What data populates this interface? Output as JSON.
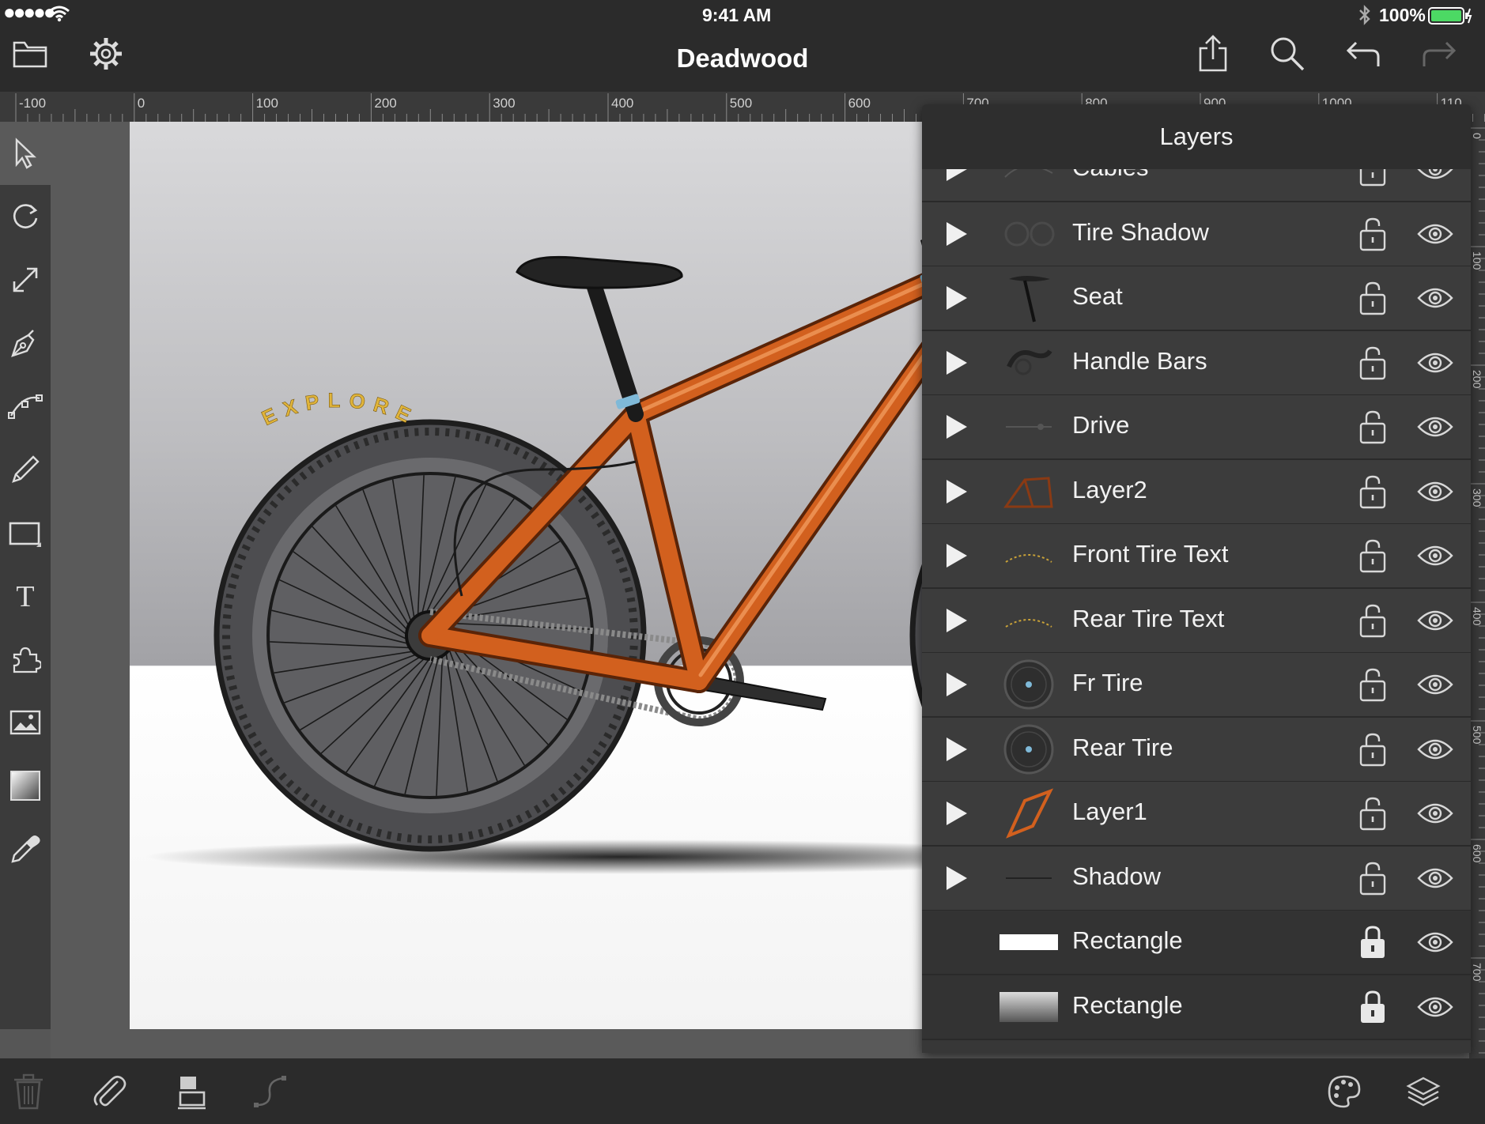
{
  "status_bar": {
    "signal": "●●●●●",
    "time": "9:41 AM",
    "battery_percent": "100%",
    "battery_level": 1.0
  },
  "nav": {
    "title": "Deadwood",
    "icons": [
      "folder-icon",
      "gear-icon",
      "share-icon",
      "search-icon",
      "undo-icon",
      "redo-icon"
    ]
  },
  "ruler": {
    "horizontal_labels": [
      "-100",
      "0",
      "100",
      "200",
      "300",
      "400",
      "500",
      "600",
      "700",
      "800",
      "900",
      "1000",
      "110"
    ],
    "vertical_labels": [
      "0",
      "100",
      "200",
      "300",
      "400",
      "500",
      "600",
      "700"
    ]
  },
  "toolbox": {
    "tools": [
      "select-tool",
      "rotate-tool",
      "scale-tool",
      "pen-tool",
      "node-tool",
      "pencil-tool",
      "rectangle-tool",
      "text-tool",
      "symbol-tool",
      "image-tool",
      "gradient-tool",
      "eyedropper-tool"
    ],
    "active": "select-tool"
  },
  "artboard": {
    "tire_text": "EXPLORE"
  },
  "layers_panel": {
    "title": "Layers",
    "layers": [
      {
        "name": "Cables",
        "has_children": true,
        "locked": false,
        "visible": true,
        "thumb": "cables"
      },
      {
        "name": "Tire Shadow",
        "has_children": true,
        "locked": false,
        "visible": true,
        "thumb": "tire-shadow"
      },
      {
        "name": "Seat",
        "has_children": true,
        "locked": false,
        "visible": true,
        "thumb": "seat"
      },
      {
        "name": "Handle Bars",
        "has_children": true,
        "locked": false,
        "visible": true,
        "thumb": "handlebars"
      },
      {
        "name": "Drive",
        "has_children": true,
        "locked": false,
        "visible": true,
        "thumb": "drive"
      },
      {
        "name": "Layer2",
        "has_children": true,
        "locked": false,
        "visible": true,
        "thumb": "frame-dark"
      },
      {
        "name": "Front Tire Text",
        "has_children": true,
        "locked": false,
        "visible": true,
        "thumb": "tire-text"
      },
      {
        "name": "Rear Tire Text",
        "has_children": true,
        "locked": false,
        "visible": true,
        "thumb": "tire-text"
      },
      {
        "name": "Fr Tire",
        "has_children": true,
        "locked": false,
        "visible": true,
        "thumb": "wheel"
      },
      {
        "name": "Rear Tire",
        "has_children": true,
        "locked": false,
        "visible": true,
        "thumb": "wheel"
      },
      {
        "name": "Layer1",
        "has_children": true,
        "locked": false,
        "visible": true,
        "thumb": "frame-orange"
      },
      {
        "name": "Shadow",
        "has_children": true,
        "locked": false,
        "visible": true,
        "thumb": "shadow"
      },
      {
        "name": "Rectangle",
        "has_children": false,
        "locked": true,
        "visible": true,
        "thumb": "rect-white"
      },
      {
        "name": "Rectangle",
        "has_children": false,
        "locked": true,
        "visible": true,
        "thumb": "rect-gradient"
      }
    ]
  },
  "bottom_bar": {
    "left_icons": [
      "trash-icon",
      "paperclip-icon",
      "align-icon",
      "path-icon"
    ],
    "right_icons": [
      "palette-icon",
      "layers-icon"
    ]
  },
  "colors": {
    "frame_orange": "#d2601e",
    "tire_text_yellow": "#e0b43a",
    "chrome_dark": "#2b2b2b",
    "panel": "#3c3c3c",
    "battery_green": "#4cd964"
  }
}
